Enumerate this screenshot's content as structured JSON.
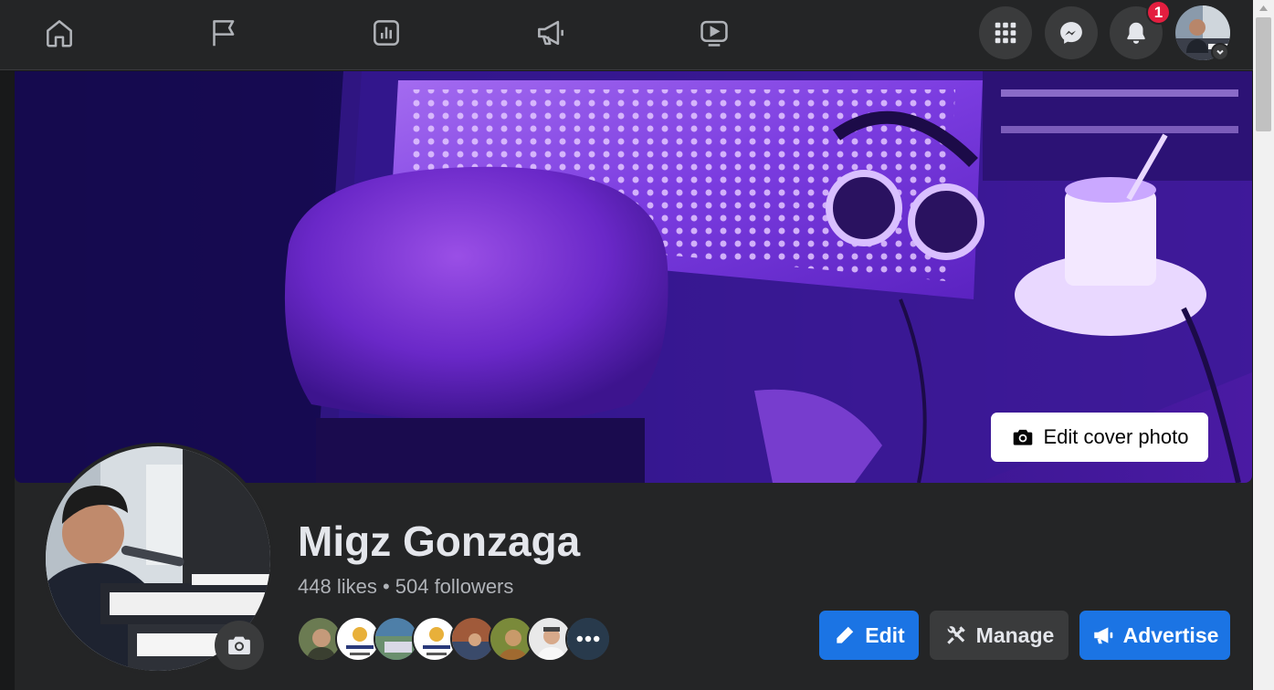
{
  "nav": {
    "items": [
      {
        "name": "home",
        "icon": "home-icon"
      },
      {
        "name": "pages",
        "icon": "flag-icon"
      },
      {
        "name": "insights",
        "icon": "bar-chart-icon"
      },
      {
        "name": "ad-center",
        "icon": "megaphone-icon"
      },
      {
        "name": "watch",
        "icon": "play-video-icon"
      }
    ],
    "menu_icon": "grid-menu-icon",
    "messenger_icon": "messenger-icon",
    "notifications_icon": "bell-icon",
    "notification_count": "1"
  },
  "cover": {
    "edit_label": "Edit cover photo"
  },
  "profile": {
    "name": "Migz Gonzaga",
    "stats": "448 likes • 504 followers"
  },
  "likers_count_visible": 8,
  "actions": {
    "edit_label": "Edit",
    "manage_label": "Manage",
    "advertise_label": "Advertise"
  },
  "colors": {
    "accent": "#1b74e4",
    "badge": "#e41e3f",
    "surface": "#242526",
    "background": "#18191a"
  }
}
